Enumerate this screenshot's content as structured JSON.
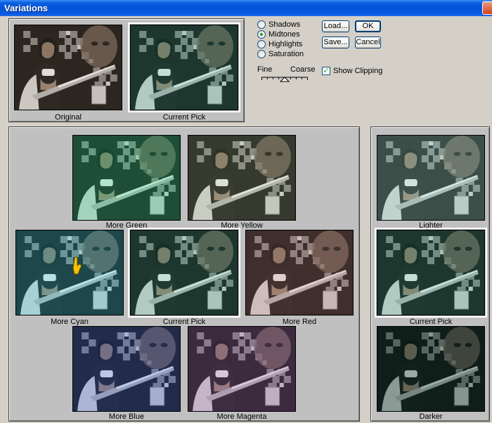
{
  "window": {
    "title": "Variations",
    "close_icon": "close-icon"
  },
  "preview": {
    "original_label": "Original",
    "current_pick_label": "Current Pick"
  },
  "tones": {
    "options": [
      {
        "label": "Shadows",
        "selected": false
      },
      {
        "label": "Midtones",
        "selected": true
      },
      {
        "label": "Highlights",
        "selected": false
      },
      {
        "label": "Saturation",
        "selected": false
      }
    ]
  },
  "slider": {
    "fine_label": "Fine",
    "coarse_label": "Coarse"
  },
  "buttons": {
    "load_label": "Load...",
    "ok_label": "OK",
    "save_label": "Save...",
    "cancel_label": "Cancel"
  },
  "clipping": {
    "label": "Show Clipping",
    "checked": true
  },
  "variations": {
    "more_green": "More Green",
    "more_yellow": "More Yellow",
    "more_cyan": "More Cyan",
    "current_pick": "Current Pick",
    "more_red": "More Red",
    "more_blue": "More Blue",
    "more_magenta": "More Magenta"
  },
  "brightness": {
    "lighter": "Lighter",
    "current_pick": "Current Pick",
    "darker": "Darker"
  },
  "colors": {
    "titlebar": "#0452d8",
    "dialog_bg": "#d4d0c8",
    "panel_bg": "#c0c0c0",
    "radio_dot": "#21a121"
  }
}
